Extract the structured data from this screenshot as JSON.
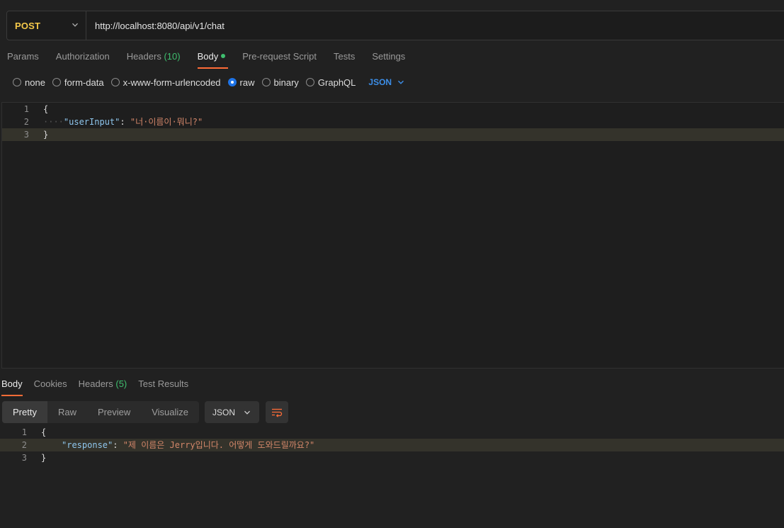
{
  "request": {
    "method": "POST",
    "url": "http://localhost:8080/api/v1/chat"
  },
  "request_tabs": [
    {
      "label": "Params"
    },
    {
      "label": "Authorization"
    },
    {
      "label": "Headers",
      "count": "(10)"
    },
    {
      "label": "Body",
      "active": true,
      "indicator": "green-dot"
    },
    {
      "label": "Pre-request Script"
    },
    {
      "label": "Tests"
    },
    {
      "label": "Settings"
    }
  ],
  "body_types": [
    {
      "label": "none",
      "checked": false
    },
    {
      "label": "form-data",
      "checked": false
    },
    {
      "label": "x-www-form-urlencoded",
      "checked": false
    },
    {
      "label": "raw",
      "checked": true
    },
    {
      "label": "binary",
      "checked": false
    },
    {
      "label": "GraphQL",
      "checked": false
    }
  ],
  "body_format": "JSON",
  "request_body": {
    "lines": [
      {
        "n": "1",
        "brace": "{"
      },
      {
        "n": "2",
        "indent": "····",
        "key": "\"userInput\"",
        "sep": ": ",
        "value": "\"너·이름이·뭐니?\""
      },
      {
        "n": "3",
        "brace": "}"
      }
    ]
  },
  "response_tabs": [
    {
      "label": "Body",
      "active": true
    },
    {
      "label": "Cookies"
    },
    {
      "label": "Headers",
      "count": "(5)"
    },
    {
      "label": "Test Results"
    }
  ],
  "view_modes": [
    "Pretty",
    "Raw",
    "Preview",
    "Visualize"
  ],
  "active_view_mode": "Pretty",
  "response_format": "JSON",
  "response_body": {
    "lines": [
      {
        "n": "1",
        "brace": "{"
      },
      {
        "n": "2",
        "key": "\"response\"",
        "sep": ": ",
        "value": "\"제 이름은 Jerry입니다. 어떻게 도와드릴까요?\""
      },
      {
        "n": "3",
        "brace": "}"
      }
    ]
  },
  "colors": {
    "accent": "#ff6c37",
    "method": "#f5c94a",
    "count": "#3fbf6f",
    "format": "#3c8ee8",
    "json_key": "#8fc7ee",
    "json_string": "#d4876a"
  },
  "icons": [
    "chevron-down-icon",
    "wrap-lines-icon"
  ]
}
